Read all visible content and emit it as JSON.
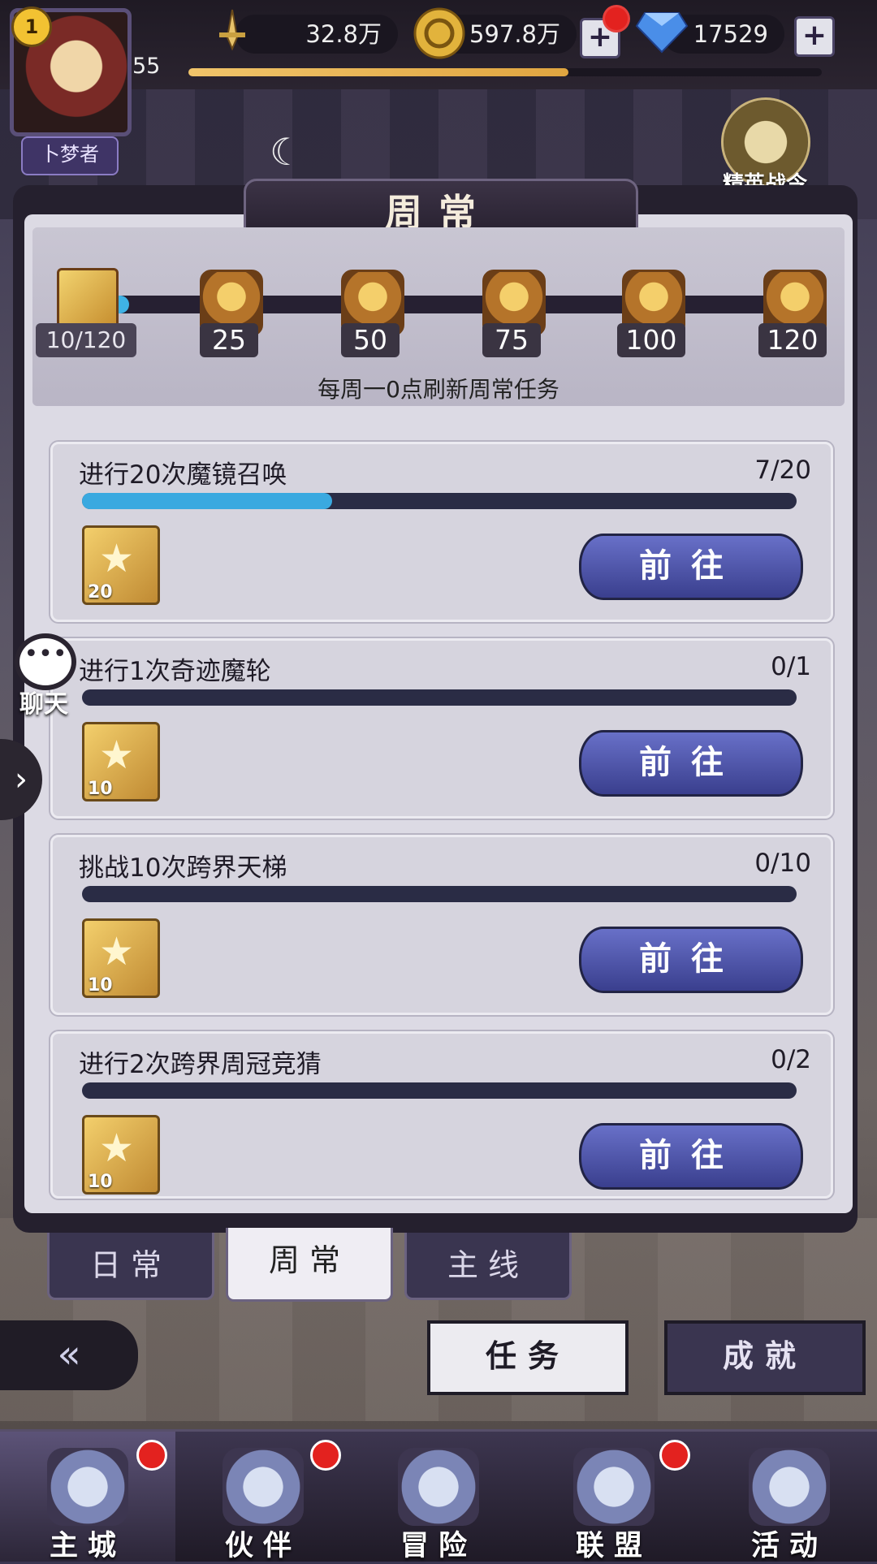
{
  "player": {
    "vip_level": "1",
    "level": "55",
    "title": "卜梦者",
    "xp_fraction": 0.6
  },
  "resources": {
    "power": "32.8万",
    "gold": "597.8万",
    "diamond": "17529"
  },
  "elite_pass": {
    "label": "精英战令"
  },
  "panel": {
    "title": "周常",
    "progress_label": "10/120",
    "progress_fraction": 0.083,
    "milestones": [
      "25",
      "50",
      "75",
      "100",
      "120"
    ],
    "refresh_note": "每周一0点刷新周常任务"
  },
  "tasks": [
    {
      "title": "进行20次魔镜召唤",
      "count": "7/20",
      "fraction": 0.35,
      "reward_qty": "20",
      "button": "前往"
    },
    {
      "title": "进行1次奇迹魔轮",
      "count": "0/1",
      "fraction": 0,
      "reward_qty": "10",
      "button": "前往"
    },
    {
      "title": "挑战10次跨界天梯",
      "count": "0/10",
      "fraction": 0,
      "reward_qty": "10",
      "button": "前往"
    },
    {
      "title": "进行2次跨界周冠竞猜",
      "count": "0/2",
      "fraction": 0,
      "reward_qty": "10",
      "button": "前往"
    }
  ],
  "tabs": [
    "日常",
    "周常",
    "主线"
  ],
  "chat": {
    "label": "聊天"
  },
  "segments": {
    "task": "任务",
    "achievement": "成就"
  },
  "nav": [
    "主城",
    "伙伴",
    "冒险",
    "联盟",
    "活动"
  ],
  "icons": {
    "power": "sword-icon",
    "gold": "coin-icon",
    "diamond": "diamond-icon",
    "moon": "moon-icon",
    "chat": "chat-icon",
    "back": "back-arrow-icon"
  },
  "colors": {
    "accent_blue": "#3fb2e5",
    "button_blue": "#4c54a8",
    "red_dot": "#e3221f"
  }
}
